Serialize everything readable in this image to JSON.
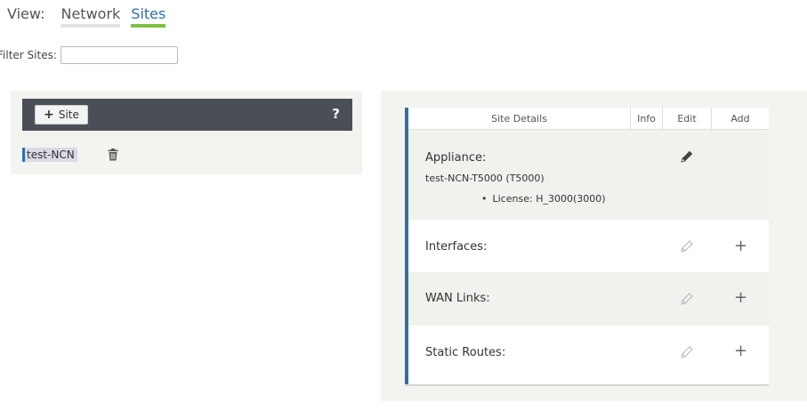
{
  "view": {
    "label": "View:",
    "tabs": [
      {
        "label": "Network",
        "active": false
      },
      {
        "label": "Sites",
        "active": true
      }
    ]
  },
  "filter": {
    "label": "Filter Sites:",
    "value": "",
    "placeholder": ""
  },
  "sites_panel": {
    "add_button_label": "Site",
    "add_button_icon": "plus-icon",
    "help_label": "?",
    "sites": [
      {
        "name": "test-NCN",
        "delete_icon": "trash-icon"
      }
    ]
  },
  "site_details": {
    "columns": {
      "site": "Site Details",
      "info": "Info",
      "edit": "Edit",
      "add": "Add"
    },
    "appliance": {
      "title": "Appliance:",
      "name": "test-NCN-T5000 (T5000)",
      "license_label": "License:",
      "license_value": "H_3000(3000)"
    },
    "sections": [
      {
        "title": "Interfaces:"
      },
      {
        "title": "WAN Links:"
      },
      {
        "title": "Static Routes:"
      }
    ]
  },
  "colors": {
    "accent_blue": "#2f6fa8",
    "active_tab_underline": "#7cc242",
    "toolbar_dark": "#4a4f57",
    "panel_bg": "#f3f3f0"
  }
}
